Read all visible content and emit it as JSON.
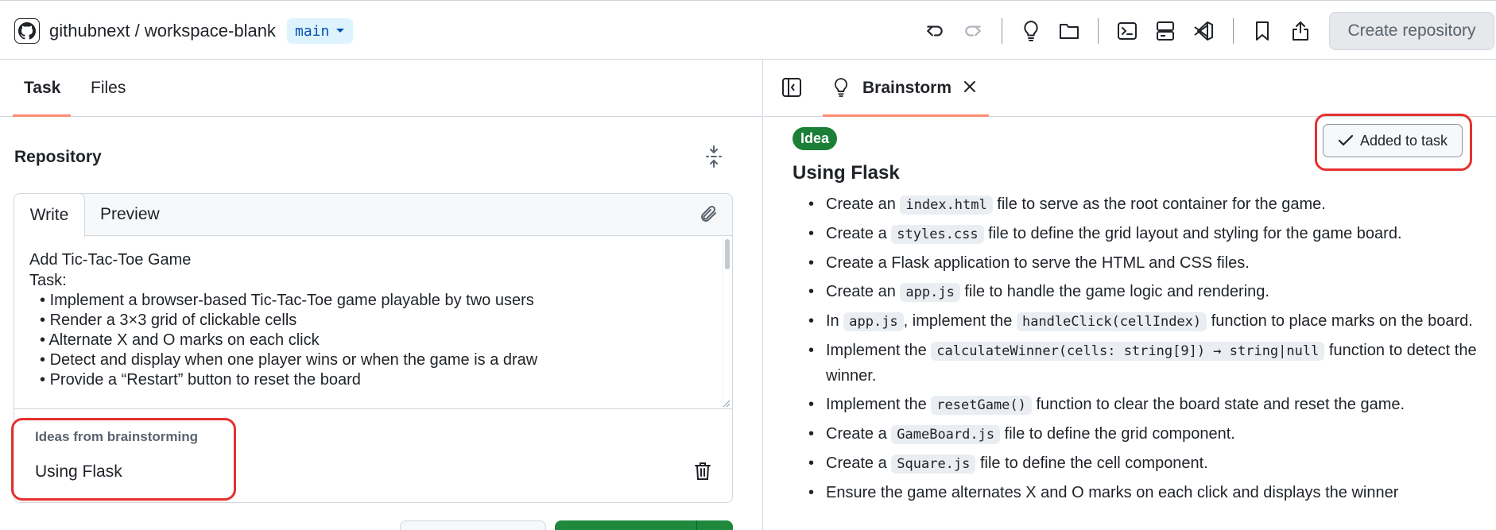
{
  "header": {
    "repo": "githubnext / workspace-blank",
    "branch": "main",
    "create_repo_label": "Create repository"
  },
  "left": {
    "tabs": [
      {
        "label": "Task"
      },
      {
        "label": "Files"
      }
    ],
    "section_title": "Repository",
    "editor": {
      "write_tab": "Write",
      "preview_tab": "Preview",
      "lines": [
        "Add Tic-Tac-Toe Game",
        "Task:"
      ],
      "bullets": [
        "Implement a browser-based Tic-Tac-Toe game playable by two users",
        "Render a 3×3 grid of clickable cells",
        "Alternate X and O marks on each click",
        "Detect and display when one player wins or when the game is a draw",
        "Provide a “Restart” button to reset the board"
      ]
    },
    "ideas": {
      "label": "Ideas from brainstorming",
      "item": "Using Flask"
    }
  },
  "right": {
    "tab_label": "Brainstorm",
    "badge": "Idea",
    "added_label": "Added to task",
    "title": "Using Flask",
    "items": [
      {
        "parts": [
          {
            "t": "Create an "
          },
          {
            "c": "index.html"
          },
          {
            "t": " file to serve as the root container for the game."
          }
        ]
      },
      {
        "parts": [
          {
            "t": "Create a "
          },
          {
            "c": "styles.css"
          },
          {
            "t": " file to define the grid layout and styling for the game board."
          }
        ]
      },
      {
        "parts": [
          {
            "t": "Create a Flask application to serve the HTML and CSS files."
          }
        ]
      },
      {
        "parts": [
          {
            "t": "Create an "
          },
          {
            "c": "app.js"
          },
          {
            "t": " file to handle the game logic and rendering."
          }
        ]
      },
      {
        "parts": [
          {
            "t": "In "
          },
          {
            "c": "app.js"
          },
          {
            "t": ", implement the "
          },
          {
            "c": "handleClick(cellIndex)"
          },
          {
            "t": " function to place marks on the board."
          }
        ]
      },
      {
        "parts": [
          {
            "t": "Implement the "
          },
          {
            "c": "calculateWinner(cells: string[9]) → string|null"
          },
          {
            "t": " function to detect the winner."
          }
        ]
      },
      {
        "parts": [
          {
            "t": "Implement the "
          },
          {
            "c": "resetGame()"
          },
          {
            "t": " function to clear the board state and reset the game."
          }
        ]
      },
      {
        "parts": [
          {
            "t": "Create a "
          },
          {
            "c": "GameBoard.js"
          },
          {
            "t": " file to define the grid component."
          }
        ]
      },
      {
        "parts": [
          {
            "t": "Create a "
          },
          {
            "c": "Square.js"
          },
          {
            "t": " file to define the cell component."
          }
        ]
      },
      {
        "parts": [
          {
            "t": "Ensure the game alternates X and O marks on each click and displays the winner"
          }
        ]
      }
    ]
  },
  "icons": {
    "toolbar": [
      "undo-icon",
      "redo-icon",
      "lightbulb-icon",
      "folder-icon",
      "terminal-icon",
      "server-icon",
      "vscode-icon",
      "bookmark-icon",
      "share-icon"
    ]
  },
  "colors": {
    "accent_underline": "#fd8c73",
    "highlight": "#e5312e",
    "badge_green": "#1a7f37",
    "branch_bg": "#ddf4ff",
    "branch_text": "#0550ae"
  }
}
